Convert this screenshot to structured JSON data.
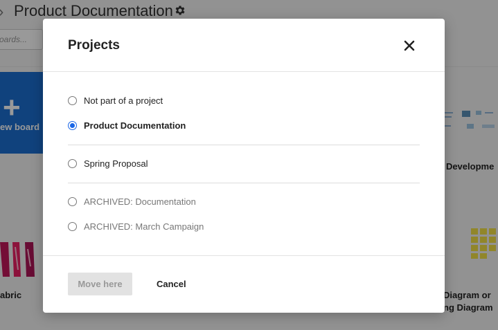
{
  "background": {
    "page_title": "Product Documentation",
    "search_placeholder": "oards...",
    "new_board_label": "ew board",
    "board_label_right_1": "t Developme",
    "board_label_left": "abric",
    "board_label_right_2a": "Diagram or",
    "board_label_right_2b": "ng Diagram"
  },
  "modal": {
    "title": "Projects",
    "options": [
      {
        "label": "Not part of a project",
        "selected": false,
        "archived": false
      },
      {
        "label": "Product Documentation",
        "selected": true,
        "archived": false
      },
      {
        "label": "Spring Proposal",
        "selected": false,
        "archived": false
      },
      {
        "label": "ARCHIVED: Documentation",
        "selected": false,
        "archived": true
      },
      {
        "label": "ARCHIVED: March Campaign",
        "selected": false,
        "archived": true
      }
    ],
    "move_button_label": "Move here",
    "cancel_button_label": "Cancel"
  },
  "colors": {
    "accent": "#1a66e6",
    "new_board_bg": "#1c6fd1",
    "overlay": "rgba(0,0,0,0.40)"
  },
  "icons": {
    "close": "close-icon",
    "settings": "gear-icon",
    "breadcrumb": "chevron-right-icon"
  }
}
